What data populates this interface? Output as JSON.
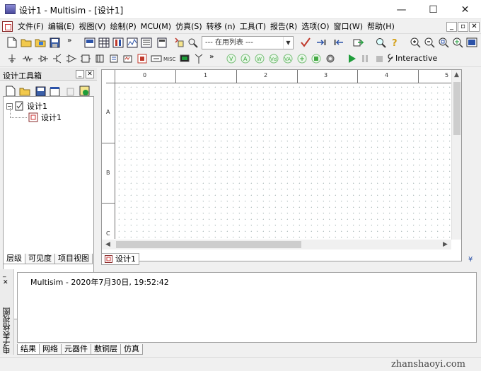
{
  "window": {
    "title": "设计1 - Multisim - [设计1]",
    "minimize_glyph": "—",
    "maximize_glyph": "☐",
    "close_glyph": "✕"
  },
  "menu": {
    "items": [
      "文件(F)",
      "编辑(E)",
      "视图(V)",
      "绘制(P)",
      "MCU(M)",
      "仿真(S)",
      "转移 (n)",
      "工具(T)",
      "报告(R)",
      "选项(O)",
      "窗口(W)",
      "帮助(H)"
    ],
    "mdi_minimize": "_",
    "mdi_restore": "▫",
    "mdi_close": "✕"
  },
  "toolbar": {
    "in_use_list": "--- 在用列表 ---",
    "interactive_label": "Interactive",
    "overflow_glyph": "»"
  },
  "toolbox": {
    "title": "设计工具箱",
    "tree": {
      "root": "设计1",
      "child": "设计1"
    },
    "tabs": [
      "层级",
      "可见度",
      "项目视图"
    ]
  },
  "schematic": {
    "column_labels": [
      "0",
      "1",
      "2",
      "3",
      "4",
      "5"
    ],
    "row_labels": [
      "A",
      "B",
      "C"
    ],
    "document_tab": "设计1"
  },
  "spreadsheet": {
    "side_label": "电子表格视图",
    "log_line": "Multisim  -  2020年7月30日, 19:52:42",
    "tabs": [
      "结果",
      "网络",
      "元器件",
      "敷铜层",
      "仿真"
    ]
  },
  "status": {
    "watermark": "zhanshaoyi.com"
  },
  "colors": {
    "accent_green": "#1f9d3a",
    "title_bar": "#ffffff",
    "chrome": "#f0f0f0"
  }
}
